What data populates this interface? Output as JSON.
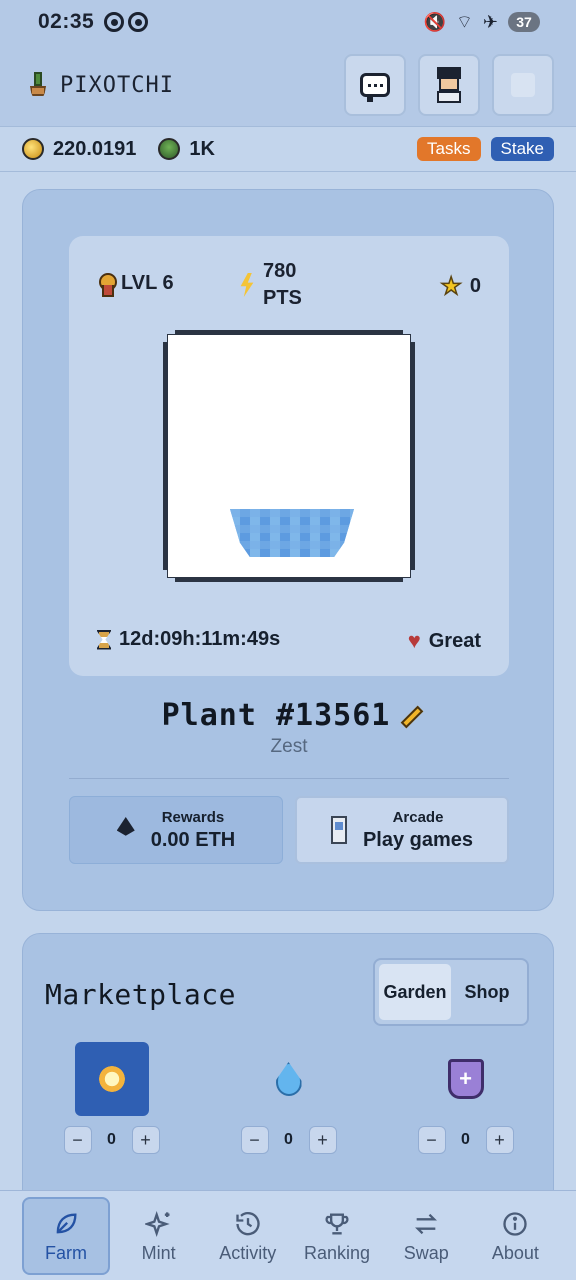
{
  "status_bar": {
    "time": "02:35",
    "battery": "37"
  },
  "header": {
    "title": "PIXOTCHI",
    "icons": [
      "plant-logo-icon",
      "chat-icon",
      "avatar",
      "blank-button"
    ]
  },
  "balances": {
    "coin": "220.0191",
    "seed": "1K",
    "tasks_label": "Tasks",
    "stake_label": "Stake"
  },
  "plant": {
    "level": "LVL 6",
    "points_value": "780",
    "points_unit": "PTS",
    "stars": "0",
    "timer": "12d:09h:11m:49s",
    "health": "Great",
    "name": "Plant #13561",
    "strain": "Zest"
  },
  "actions": {
    "rewards_label": "Rewards",
    "rewards_value": "0.00 ETH",
    "arcade_label": "Arcade",
    "arcade_value": "Play games"
  },
  "marketplace": {
    "title": "Marketplace",
    "tabs": [
      "Garden",
      "Shop"
    ],
    "active_tab": "Garden",
    "items": [
      {
        "icon": "sun-icon",
        "qty": "0",
        "selected": true
      },
      {
        "icon": "water-drop-icon",
        "qty": "0",
        "selected": false
      },
      {
        "icon": "fertilizer-bucket-icon",
        "qty": "0",
        "selected": false
      }
    ]
  },
  "nav": {
    "items": [
      "Farm",
      "Mint",
      "Activity",
      "Ranking",
      "Swap",
      "About"
    ],
    "active": "Farm"
  },
  "colors": {
    "accent": "#2f5fb3",
    "tasks": "#e2772a",
    "background": "#c3d5ec",
    "card": "#a9c2e3"
  }
}
